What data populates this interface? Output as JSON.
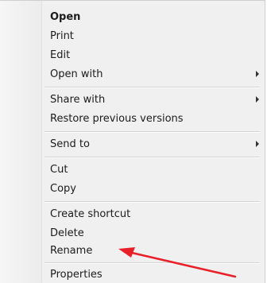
{
  "menu": {
    "items": [
      {
        "label": "Open"
      },
      {
        "label": "Print"
      },
      {
        "label": "Edit"
      },
      {
        "label": "Open with"
      },
      {
        "label": "Share with"
      },
      {
        "label": "Restore previous versions"
      },
      {
        "label": "Send to"
      },
      {
        "label": "Cut"
      },
      {
        "label": "Copy"
      },
      {
        "label": "Create shortcut"
      },
      {
        "label": "Delete"
      },
      {
        "label": "Rename"
      },
      {
        "label": "Properties"
      }
    ]
  },
  "annotation": {
    "arrow_color": "#e8202a",
    "target": "Rename"
  },
  "colors": {
    "menu_background": "#f0f0f0",
    "text": "#1c1c1c"
  }
}
